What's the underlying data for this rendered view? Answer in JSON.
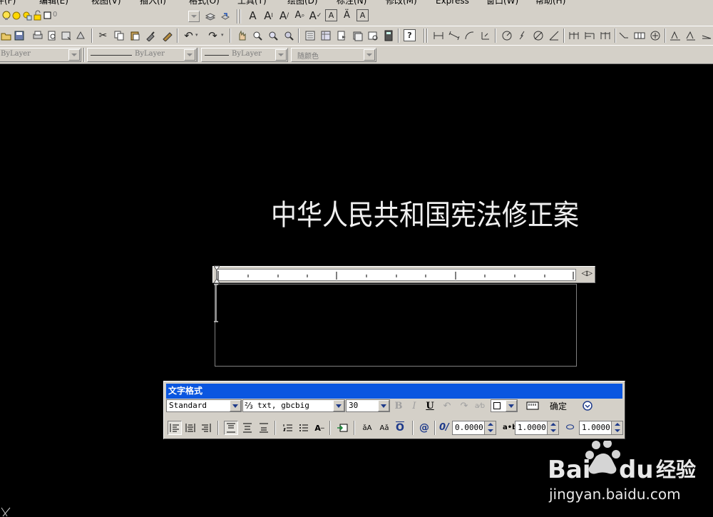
{
  "menubar": {
    "items": [
      "件(F)",
      "编辑(E)",
      "视图(V)",
      "插入(I)",
      "格式(O)",
      "工具(T)",
      "绘图(D)",
      "标注(N)",
      "修改(M)",
      "Express",
      "窗口(W)",
      "帮助(H)"
    ]
  },
  "toolbars": {
    "layer_value": "0",
    "color_combo": "ByLayer",
    "linetype_combo": "ByLayer",
    "lineweight_combo": "ByLayer",
    "plotstyle_combo": "随颜色"
  },
  "drawing": {
    "text": "中华人民共和国宪法修正案"
  },
  "text_format": {
    "title": "文字格式",
    "style": "Standard",
    "font": "txt, gbcbig",
    "height": "30",
    "bold": "B",
    "italic": "I",
    "underline": "U",
    "ok_label": "确定",
    "oblique": "0.0000",
    "tracking": "1.0000",
    "width_factor": "1.0000",
    "tracking_label": "a•b"
  },
  "colors": {
    "canvas": "#000000",
    "title_bar": "#0a56e0",
    "chrome": "#d4d0c8"
  }
}
